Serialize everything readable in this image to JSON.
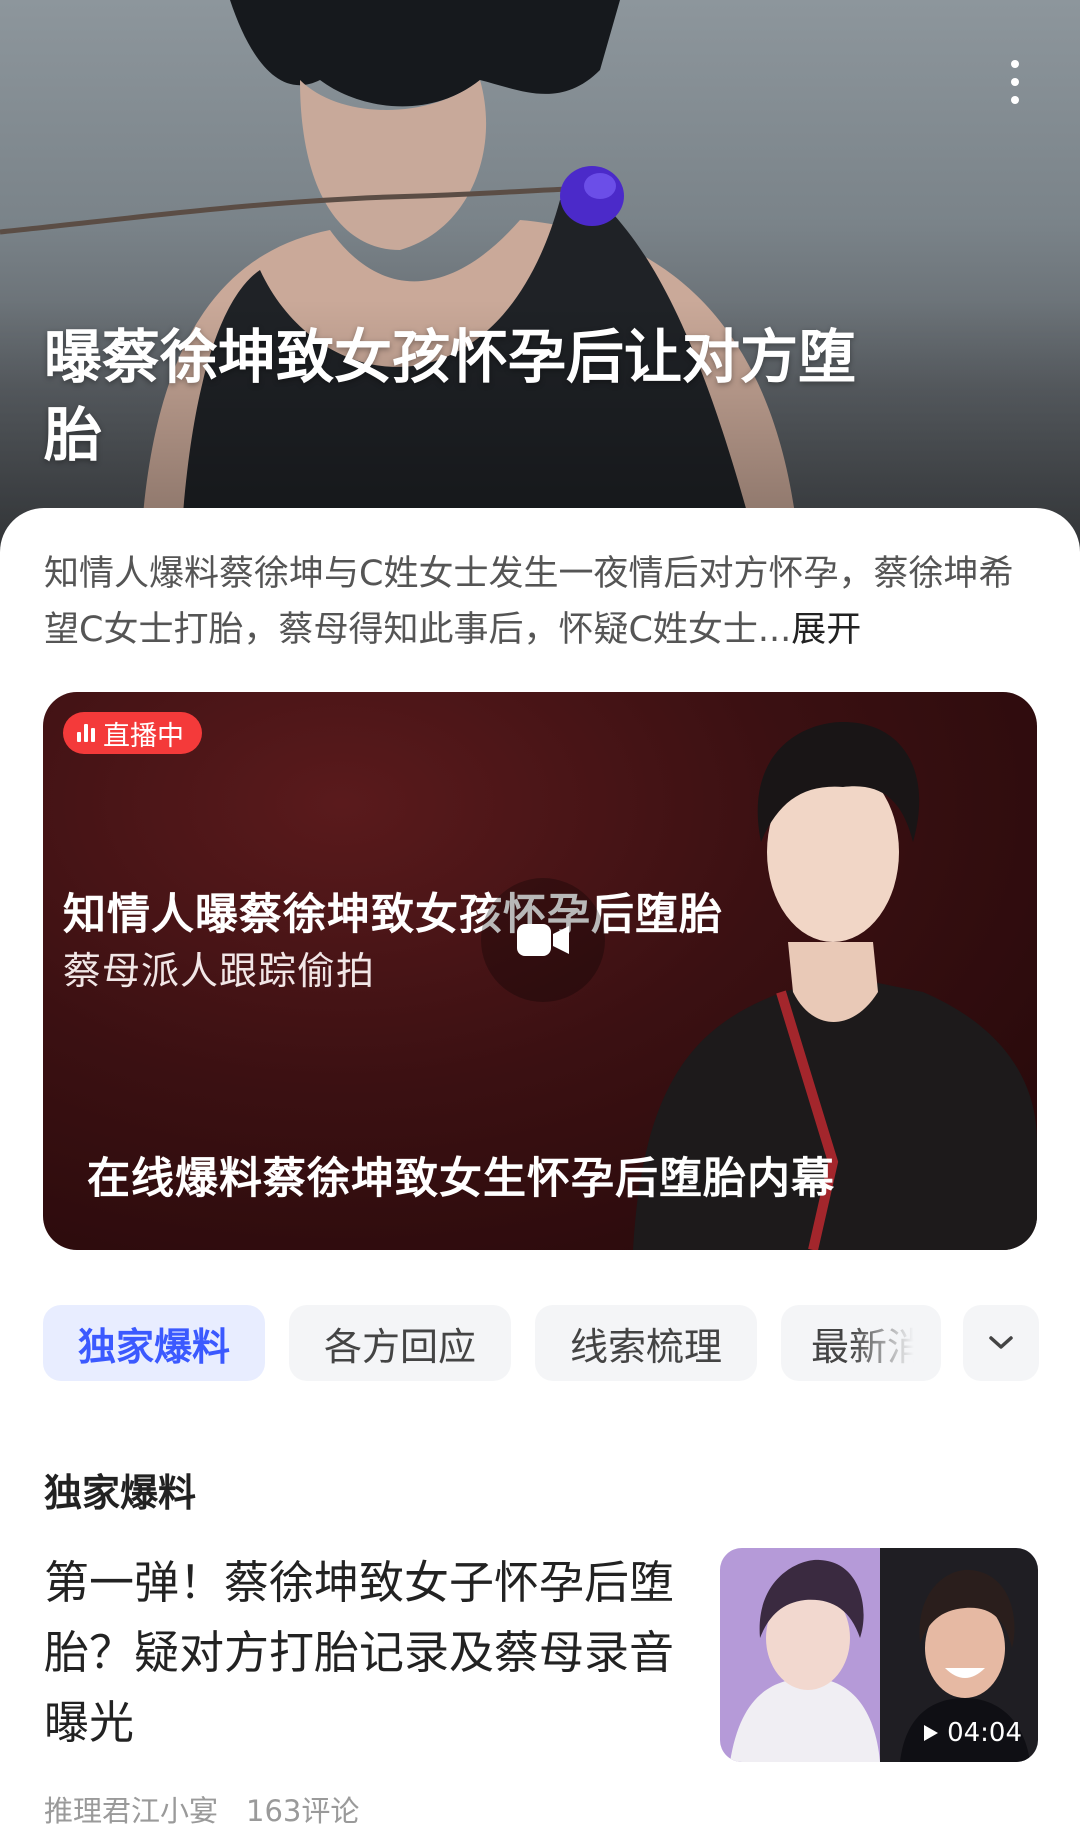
{
  "hero": {
    "title": "曝蔡徐坤致女孩怀孕后让对方堕胎",
    "more_icon": "more-vertical-icon"
  },
  "summary": {
    "text": "知情人爆料蔡徐坤与C姓女士发生一夜情后对方怀孕，蔡徐坤希望C女士打胎，蔡母得知此事后，怀疑C姓女士...",
    "expand_label": "展开"
  },
  "live_card": {
    "badge": "直播中",
    "headline": "知情人曝蔡徐坤致女孩怀孕后堕胎",
    "subheadline": "蔡母派人跟踪偷拍",
    "caption": "在线爆料蔡徐坤致女生怀孕后堕胎内幕",
    "play_icon": "video-camera-icon",
    "badge_color": "#f43a3a"
  },
  "tabs": {
    "items": [
      "独家爆料",
      "各方回应",
      "线索梳理",
      "最新消"
    ],
    "active_index": 0,
    "expand_icon": "chevron-down-icon",
    "active_color": "#3b59ff"
  },
  "section": {
    "title": "独家爆料"
  },
  "article": {
    "headline": "第一弹！蔡徐坤致女子怀孕后堕胎？疑对方打胎记录及蔡母录音曝光",
    "duration": "04:04",
    "author": "推理君江小宴",
    "comments": "163评论"
  }
}
